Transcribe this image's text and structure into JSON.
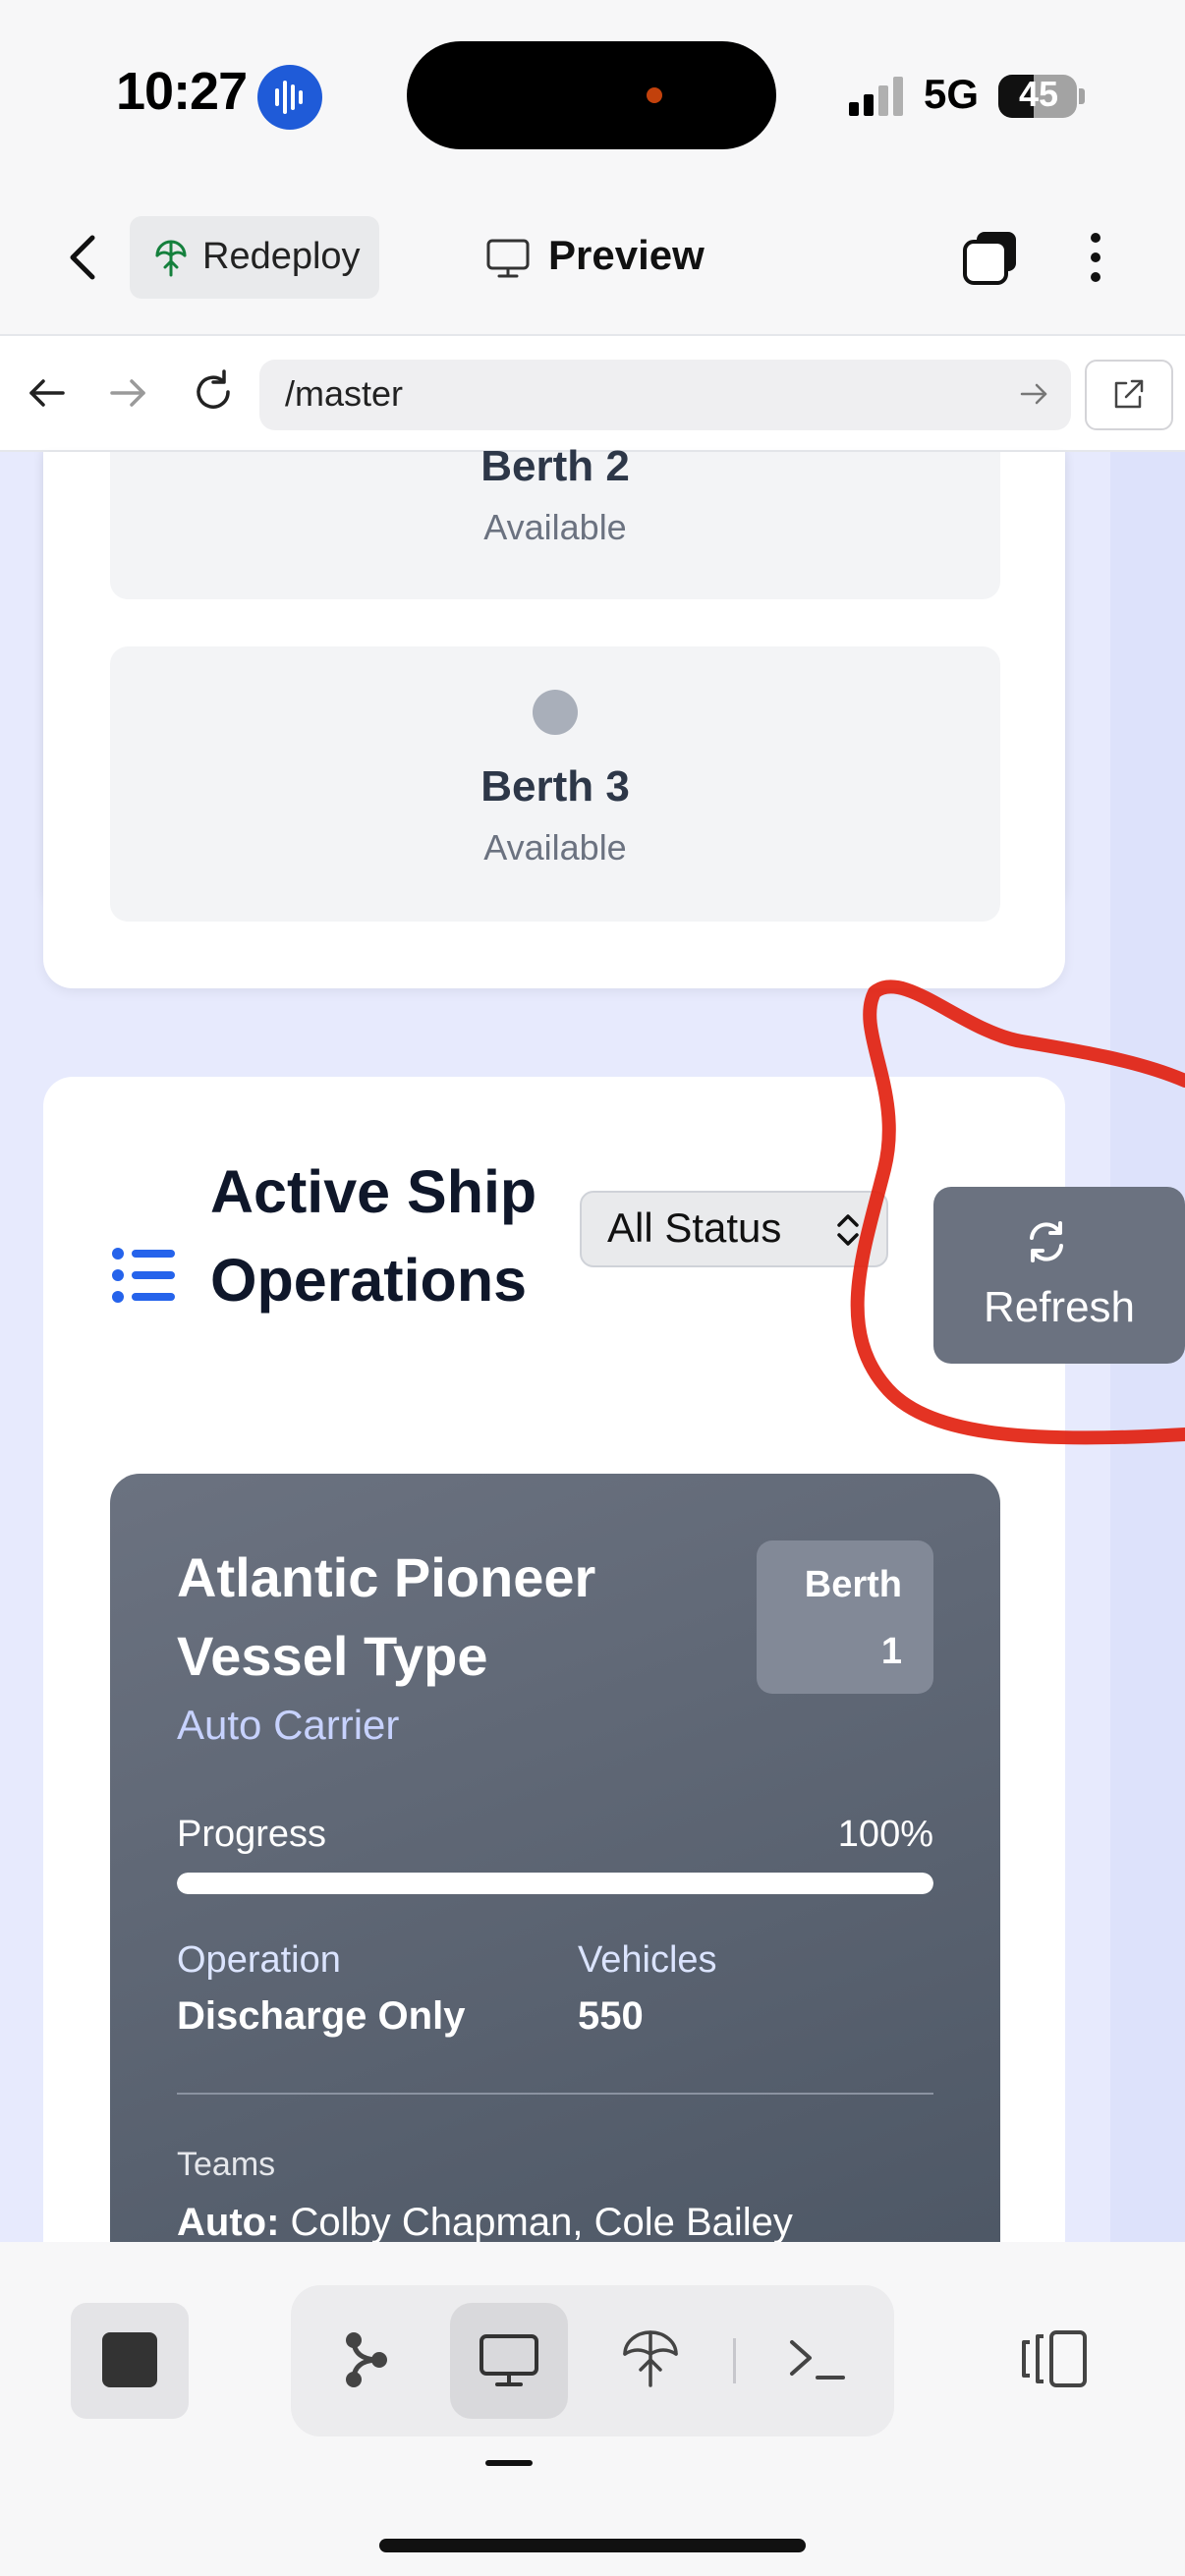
{
  "status_bar": {
    "time": "10:27",
    "network": "5G",
    "battery": "45"
  },
  "toolbar": {
    "redeploy_label": "Redeploy",
    "preview_label": "Preview"
  },
  "browser": {
    "url": "/master"
  },
  "berths": [
    {
      "name": "Berth 2",
      "status": "Available"
    },
    {
      "name": "Berth 3",
      "status": "Available"
    }
  ],
  "operations": {
    "title": "Active Ship Operations",
    "status_filter": "All Status",
    "refresh_label": "Refresh"
  },
  "ship": {
    "name": "Atlantic Pioneer Vessel Type",
    "type": "Auto Carrier",
    "berth_label": "Berth",
    "berth_number": "1",
    "progress_label": "Progress",
    "progress_value": "100%",
    "progress_fraction": 1.0,
    "operation_label": "Operation",
    "operation_value": "Discharge Only",
    "vehicles_label": "Vehicles",
    "vehicles_value": "550",
    "teams_label": "Teams",
    "teams_prefix": "Auto:",
    "teams_members": "Colby Chapman, Cole Bailey"
  },
  "colors": {
    "accent": "#2563eb",
    "annotation": "#e11d0b",
    "card_bg": "#5b6270",
    "page_bg": "#e7eafd"
  },
  "icons": {
    "status_bar": [
      "siri-icon",
      "signal-icon",
      "battery-icon"
    ],
    "toolbar": [
      "back-chevron-icon",
      "redeploy-icon",
      "preview-monitor-icon",
      "tabs-icon",
      "more-icon"
    ],
    "browser": [
      "back-arrow-icon",
      "forward-arrow-icon",
      "reload-icon",
      "go-arrow-icon",
      "open-external-icon"
    ],
    "bottom": [
      "stop-icon",
      "branch-icon",
      "monitor-icon",
      "deploy-icon",
      "terminal-icon",
      "panel-icon"
    ]
  }
}
